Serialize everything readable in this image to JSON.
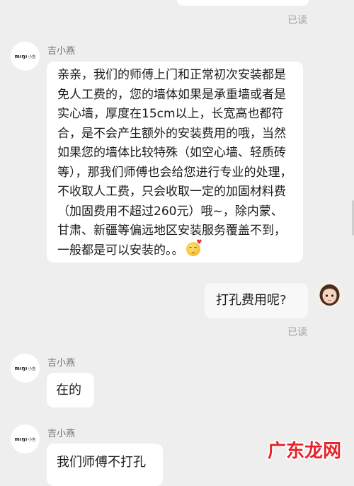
{
  "messages": {
    "top_read_status": "已读",
    "sender_name_1": "吉小燕",
    "agent_message_1": "亲亲，我们的师傅上门和正常初次安装都是免人工费的，您的墙体如果是承重墙或者是实心墙，厚度在15cm以上，长宽高也都符合，是不会产生额外的安装费用的哦，当然如果您的墙体比较特殊（如空心墙、轻质砖等），那我们师傅也会给您进行专业的处理，不收取人工费，只会收取一定的加固材料费（加固费用不超过260元）哦~，除内蒙、甘肃、新疆等偏远地区安装服务覆盖不到，一般都是可以安装的。。",
    "user_message_1": "打孔费用呢?",
    "user_read_status": "已读",
    "sender_name_2": "吉小燕",
    "agent_message_2": "在的",
    "sender_name_3": "吉小燕",
    "agent_message_3": "我们师傅不打孔"
  },
  "brand_avatar": {
    "latin": "mıŋı",
    "cjk": "小吉"
  },
  "watermark": {
    "text": "广东龙网"
  },
  "icons": {
    "emoji": "smiling-face-with-heart-emoji",
    "brand_avatar": "minij-logo-avatar",
    "user_avatar": "user-avatar-girl"
  },
  "colors": {
    "background": "#eeeeee",
    "bubble": "#ffffff",
    "read_status": "#a0a0a0",
    "watermark": "#e8222a"
  }
}
